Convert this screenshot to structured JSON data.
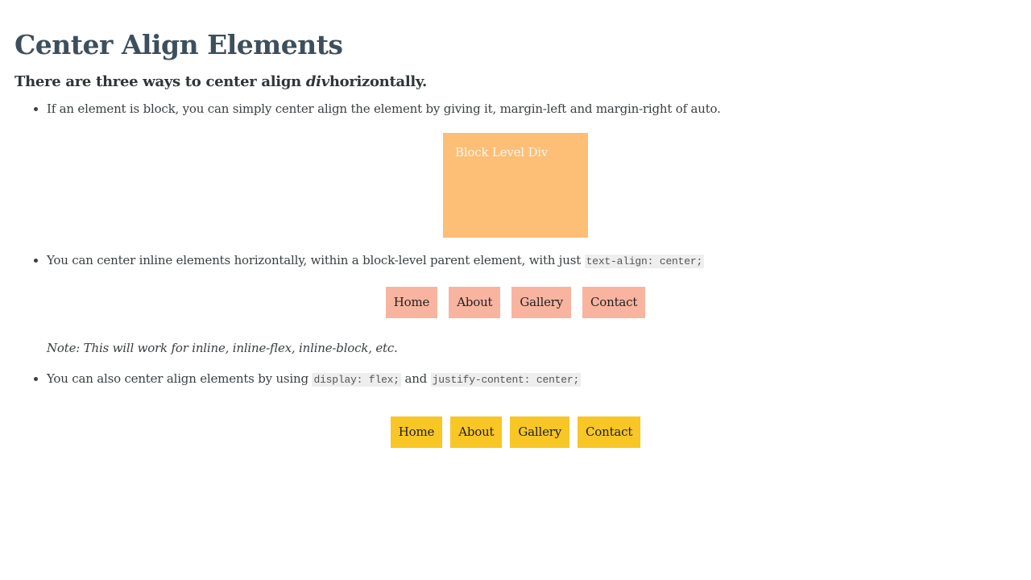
{
  "page": {
    "title": "Center Align Elements",
    "subtitle": {
      "before": "There are three ways to center align ",
      "emphasis": "div",
      "after": "horizontally."
    }
  },
  "sections": [
    {
      "text": "If an element is block, you can simply center align the element by giving it, margin-left and margin-right of auto.",
      "demo_label": "Block Level Div"
    },
    {
      "text": "You can center inline elements horizontally, within a block-level parent element, with just ",
      "code": "text-align: center;",
      "nav": [
        "Home",
        "About",
        "Gallery",
        "Contact"
      ],
      "note": "Note: This will work for inline, inline-flex, inline-block, etc."
    },
    {
      "text": "You can also center align elements by using ",
      "code1": "display: flex;",
      "joiner": " and ",
      "code2": "justify-content: center;",
      "nav": [
        "Home",
        "About",
        "Gallery",
        "Contact"
      ]
    }
  ],
  "colors": {
    "block_demo": "#fdbe76",
    "inline_nav": "#f9b4a0",
    "flex_nav": "#f8c625"
  }
}
